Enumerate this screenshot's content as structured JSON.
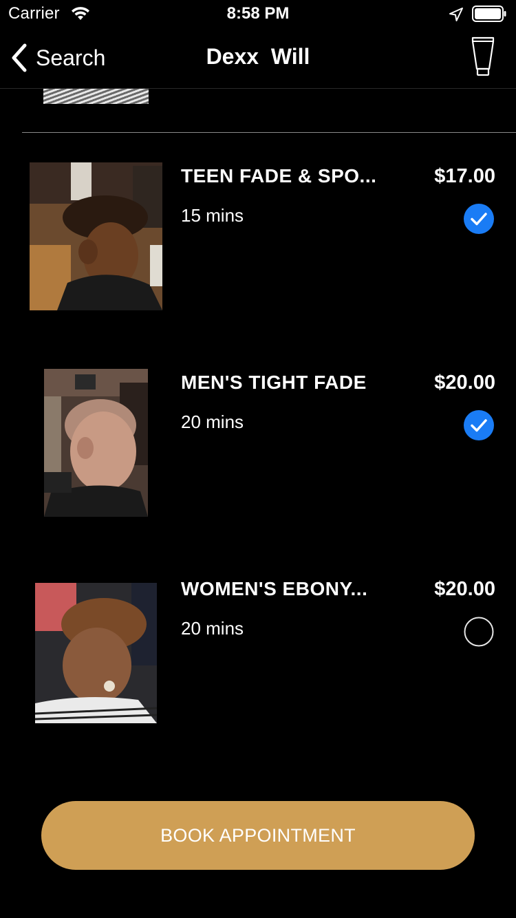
{
  "status_bar": {
    "carrier": "Carrier",
    "time": "8:58 PM"
  },
  "nav": {
    "back_label": "Search",
    "title": "Dexx  Will"
  },
  "services": [
    {
      "name": "TEEN FADE & SPO...",
      "duration": "15 mins",
      "price": "$17.00",
      "selected": true
    },
    {
      "name": "MEN'S TIGHT FADE",
      "duration": "20 mins",
      "price": "$20.00",
      "selected": true
    },
    {
      "name": "WOMEN'S EBONY...",
      "duration": "20 mins",
      "price": "$20.00",
      "selected": false
    }
  ],
  "book_button": {
    "label": "BOOK APPOINTMENT"
  },
  "colors": {
    "background": "#000000",
    "accent_gold": "#cf9f55",
    "check_blue": "#1a7cf5"
  },
  "icons": {
    "wifi": "wifi-icon",
    "location": "location-arrow-icon",
    "battery": "battery-icon",
    "back": "chevron-left-icon",
    "cart": "hair-product-tube-icon",
    "checked": "checkmark-circle-icon",
    "unchecked": "empty-circle-icon"
  }
}
